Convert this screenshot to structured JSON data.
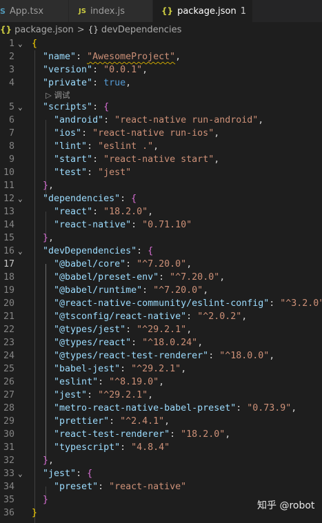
{
  "tabs": [
    {
      "icon": "S",
      "label": "App.tsx"
    },
    {
      "icon": "JS",
      "label": "index.js"
    },
    {
      "icon": "{}",
      "label": "package.json",
      "modified": "1",
      "close": "✕"
    }
  ],
  "breadcrumb": {
    "file": "package.json",
    "separator": ">",
    "object_icon": "{}",
    "symbol": "devDependencies"
  },
  "codelens": {
    "label": "调试",
    "icon": "▷"
  },
  "line_numbers": [
    "1",
    "2",
    "3",
    "4",
    "5",
    "6",
    "7",
    "8",
    "9",
    "10",
    "11",
    "12",
    "13",
    "14",
    "15",
    "16",
    "17",
    "18",
    "19",
    "20",
    "21",
    "22",
    "23",
    "24",
    "25",
    "26",
    "27",
    "28",
    "29",
    "30",
    "31",
    "32",
    "33",
    "34",
    "35",
    "36"
  ],
  "code": {
    "name_key": "\"name\"",
    "name_val": "\"AwesomeProject\"",
    "version_key": "\"version\"",
    "version_val": "\"0.0.1\"",
    "private_key": "\"private\"",
    "private_val": "true",
    "scripts_key": "\"scripts\"",
    "android_key": "\"android\"",
    "android_val": "\"react-native run-android\"",
    "ios_key": "\"ios\"",
    "ios_val": "\"react-native run-ios\"",
    "lint_key": "\"lint\"",
    "lint_val": "\"eslint .\"",
    "start_key": "\"start\"",
    "start_val": "\"react-native start\"",
    "test_key": "\"test\"",
    "test_val": "\"jest\"",
    "dependencies_key": "\"dependencies\"",
    "react_key": "\"react\"",
    "react_val": "\"18.2.0\"",
    "rn_key": "\"react-native\"",
    "rn_val": "\"0.71.10\"",
    "devdeps_key": "\"devDependencies\"",
    "d1_key": "\"@babel/core\"",
    "d1_val": "\"^7.20.0\"",
    "d2_key": "\"@babel/preset-env\"",
    "d2_val": "\"^7.20.0\"",
    "d3_key": "\"@babel/runtime\"",
    "d3_val": "\"^7.20.0\"",
    "d4_key": "\"@react-native-community/eslint-config\"",
    "d4_val": "\"^3.2.0\"",
    "d5_key": "\"@tsconfig/react-native\"",
    "d5_val": "\"^2.0.2\"",
    "d6_key": "\"@types/jest\"",
    "d6_val": "\"^29.2.1\"",
    "d7_key": "\"@types/react\"",
    "d7_val": "\"^18.0.24\"",
    "d8_key": "\"@types/react-test-renderer\"",
    "d8_val": "\"^18.0.0\"",
    "d9_key": "\"babel-jest\"",
    "d9_val": "\"^29.2.1\"",
    "d10_key": "\"eslint\"",
    "d10_val": "\"^8.19.0\"",
    "d11_key": "\"jest\"",
    "d11_val": "\"^29.2.1\"",
    "d12_key": "\"metro-react-native-babel-preset\"",
    "d12_val": "\"0.73.9\"",
    "d13_key": "\"prettier\"",
    "d13_val": "\"^2.4.1\"",
    "d14_key": "\"react-test-renderer\"",
    "d14_val": "\"18.2.0\"",
    "d15_key": "\"typescript\"",
    "d15_val": "\"4.8.4\"",
    "jest_key": "\"jest\"",
    "preset_key": "\"preset\"",
    "preset_val": "\"react-native\""
  },
  "watermark": "知乎 @robot",
  "colors": {
    "background": "#1e1e1e",
    "key": "#9cdcfe",
    "string": "#ce9178",
    "keyword": "#569cd6",
    "bracket_level1": "#ffd700",
    "bracket_level2": "#da70d6"
  }
}
